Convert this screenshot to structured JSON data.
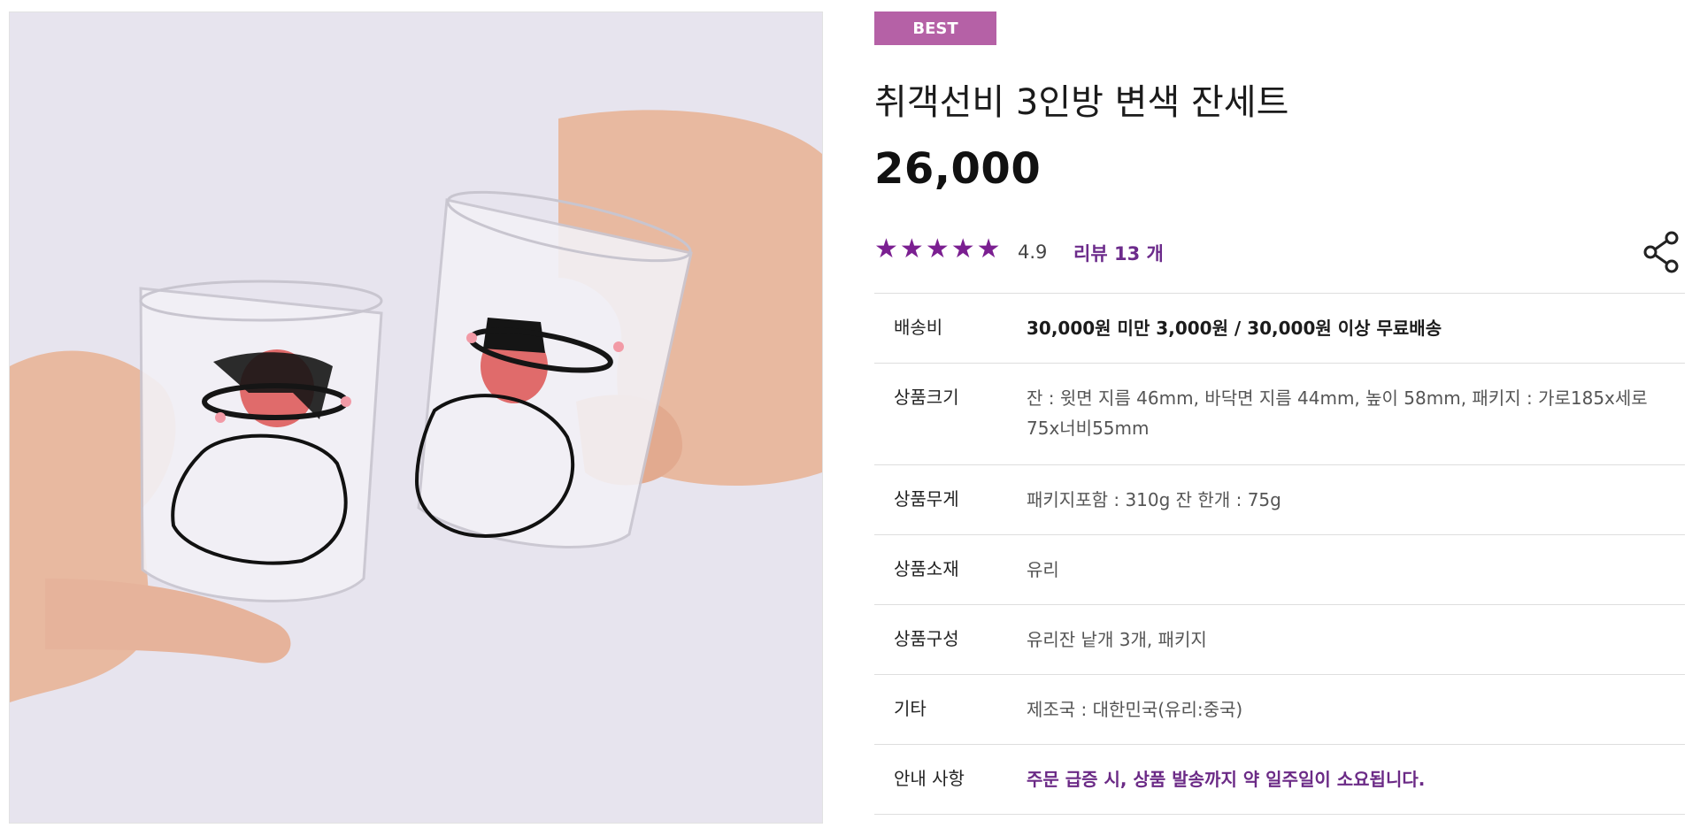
{
  "product": {
    "badge": "BEST",
    "title": "취객선비 3인방 변색 잔세트",
    "price": "26,000",
    "rating": {
      "stars": 5,
      "score": "4.9",
      "review_label": "리뷰 13 개"
    },
    "colors": {
      "accent_badge": "#b561a6",
      "star": "#7b1f91",
      "notice": "#6b2a86"
    },
    "specs": [
      {
        "label": "배송비",
        "value": "30,000원 미만 3,000원 / 30,000원 이상 무료배송"
      },
      {
        "label": "상품크기",
        "value": "잔 : 윗면 지름 46mm, 바닥면 지름 44mm, 높이 58mm, 패키지 : 가로185x세로75x너비55mm"
      },
      {
        "label": "상품무게",
        "value": "패키지포함 : 310g 잔 한개 : 75g"
      },
      {
        "label": "상품소재",
        "value": "유리"
      },
      {
        "label": "상품구성",
        "value": "유리잔 낱개 3개, 패키지"
      },
      {
        "label": "기타",
        "value": "제조국 : 대한민국(유리:중국)"
      },
      {
        "label": "안내 사항",
        "value": "주문 급증 시, 상품 발송까지 약 일주일이 소요됩니다."
      }
    ]
  }
}
